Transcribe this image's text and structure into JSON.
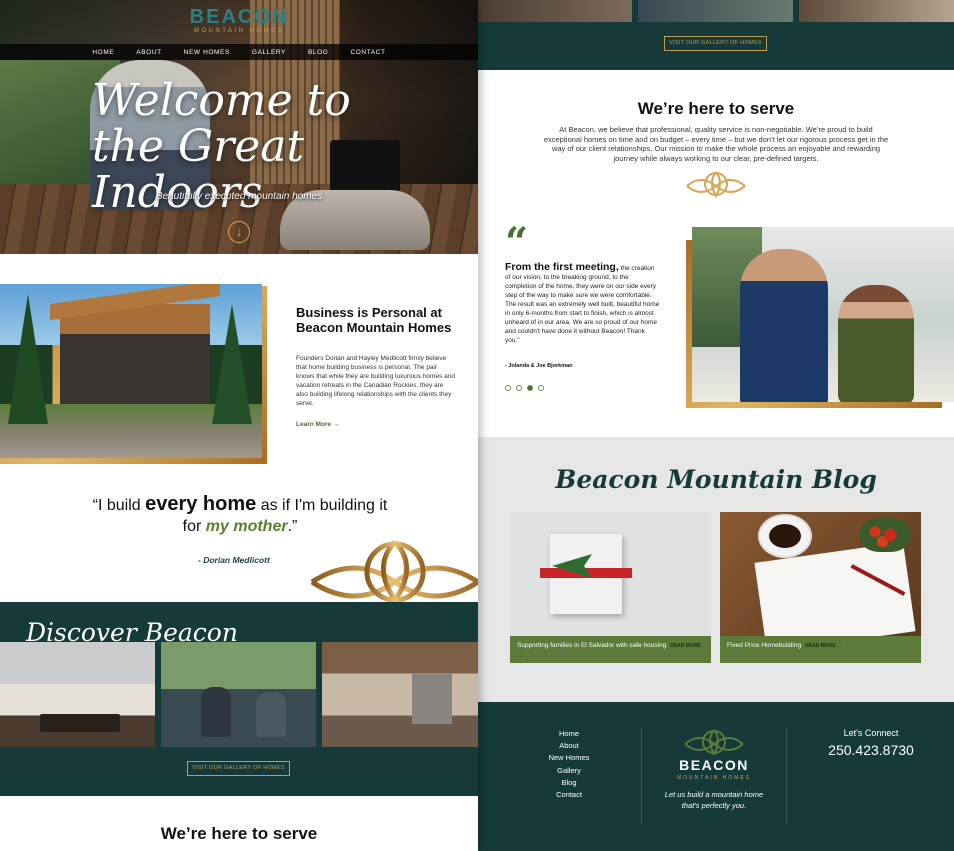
{
  "hero": {
    "brand": "BEACON",
    "brand_sub": "MOUNTAIN HOMES",
    "nav": [
      "HOME",
      "ABOUT",
      "NEW HOMES",
      "GALLERY",
      "BLOG",
      "CONTACT"
    ],
    "title_line1": "Welcome to",
    "title_line2": "the Great Indoors",
    "subtitle": "Beautifully executed mountain homes",
    "scroll_icon": "arrow-down-circle-icon"
  },
  "business": {
    "title": "Business is Personal at Beacon Mountain Homes",
    "text": "Founders Dorian and Hayley Medlicott firmly believe that home building business is personal. The pair knows that while they are building luxurious homes and vacation retreats in the Canadian Rockies, they are also building lifelong relationships with the clients they serve.",
    "learn_more": "Learn More →"
  },
  "quote": {
    "part1": "“I build ",
    "bold": "every home",
    "part2": " as if I'm building it for ",
    "green": "my mother",
    "part3": ".”",
    "author": "- Dorian Medlicott"
  },
  "discover": {
    "title": "Discover Beacon",
    "gallery_button": "VISIT OUR GALLERY OF HOMES"
  },
  "serve": {
    "title": "We’re here to serve",
    "text": "At Beacon, we believe that professional, quality service is non-negotiable. We’re proud to build exceptional homes on time and on budget – every time – but we don’t let our rigorous process get in the way of our client relationships. Our mission to make the whole process an enjoyable and rewarding journey while always working to our clear, pre-defined targets."
  },
  "testimonial": {
    "lead": "From the first meeting,",
    "text": " the creation of our vision, to the breaking ground, to the completion of the home, they were on our side every step of the way to make sure we were comfortable. The result was an extremely well built, beautiful home in only 6-months from start to finish, which is almost unheard of in our area. We are so proud of our home and couldn't have done it without Beacon! Thank you.\"",
    "author": "- Jolanda & Joe Bjorkman",
    "dots_total": 4,
    "dots_active_index": 2
  },
  "blog": {
    "title": "Beacon Mountain Blog",
    "posts": [
      {
        "title": "Supporting families in El Salvador with safe housing",
        "more": "READ MORE →"
      },
      {
        "title": "Fixed Price Homebuilding",
        "more": "READ MORE →"
      }
    ]
  },
  "footer": {
    "links": [
      "Home",
      "About",
      "New Homes",
      "Gallery",
      "Blog",
      "Contact"
    ],
    "brand": "BEACON",
    "brand_sub": "MOUNTAIN HOMES",
    "tagline": "Let us build a mountain home that's perfectly you.",
    "connect_label": "Let's Connect",
    "phone": "250.423.8730"
  },
  "colors": {
    "teal_dark": "#163a3a",
    "gold": "#c69c53",
    "green": "#4a6f2e",
    "brand_teal": "#2b7f86"
  }
}
